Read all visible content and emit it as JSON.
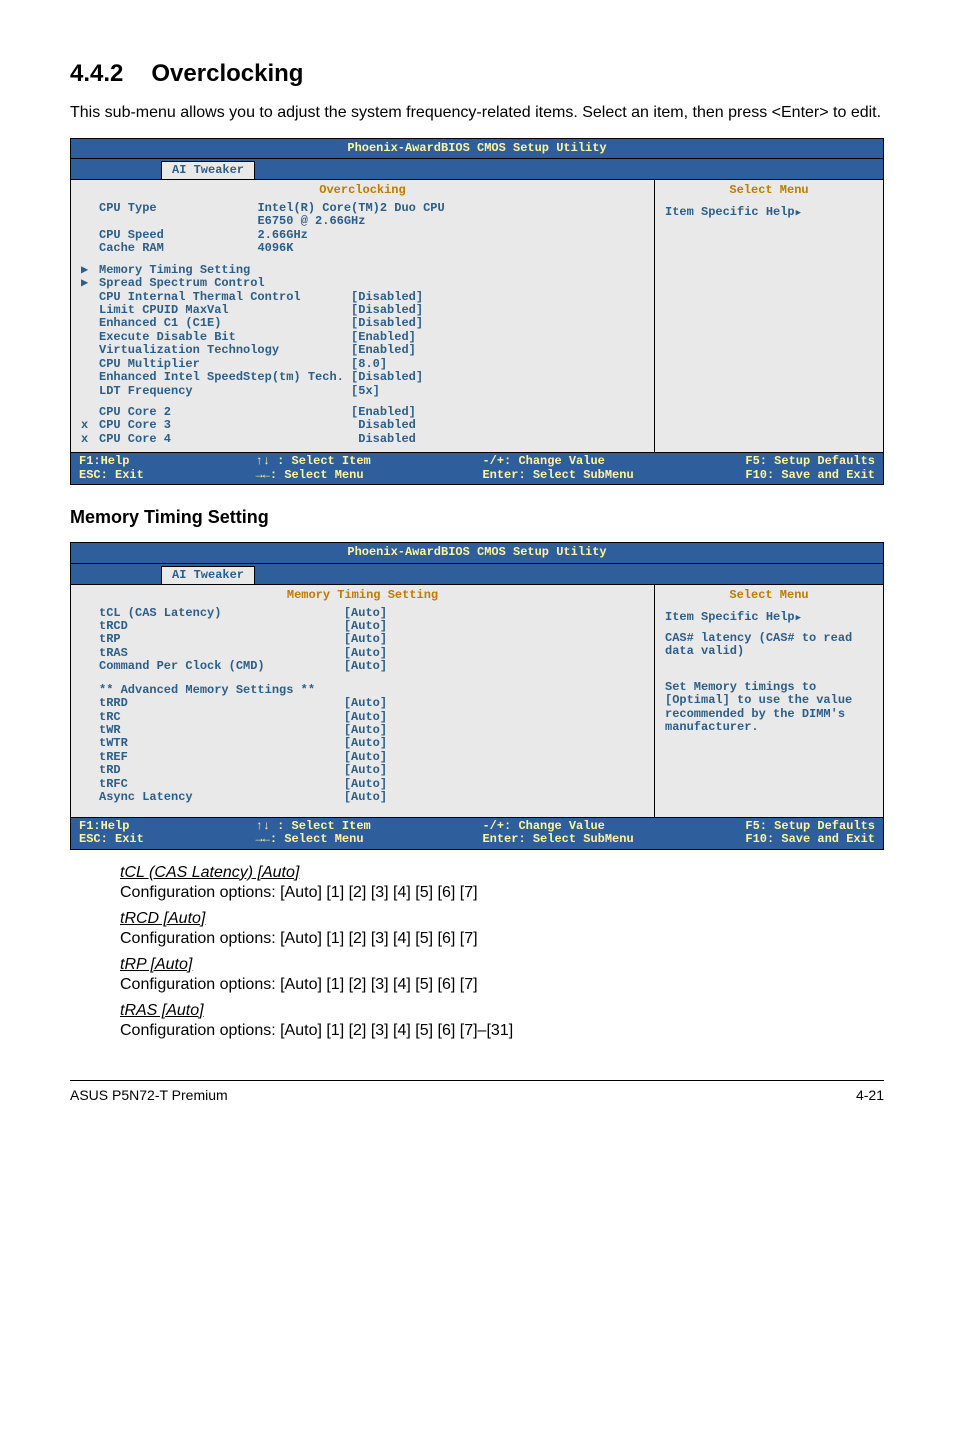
{
  "heading": {
    "number": "4.4.2",
    "title": "Overclocking"
  },
  "intro": "This sub-menu allows you to adjust the system frequency-related items. Select an item, then press <Enter> to edit.",
  "bios1": {
    "title": "Phoenix-AwardBIOS CMOS Setup Utility",
    "tab": "AI Tweaker",
    "left_header": "Overclocking",
    "right_header": "Select Menu",
    "help": "Item Specific Help",
    "info": [
      {
        "l": "CPU Type",
        "v": "Intel(R) Core(TM)2 Duo CPU"
      },
      {
        "l": "",
        "v": "E6750 @ 2.66GHz"
      },
      {
        "l": "CPU Speed",
        "v": "2.66GHz"
      },
      {
        "l": "Cache RAM",
        "v": "4096K"
      }
    ],
    "items": [
      {
        "p": "▶",
        "l": "Memory Timing Setting",
        "v": ""
      },
      {
        "p": "▶",
        "l": "Spread Spectrum Control",
        "v": ""
      },
      {
        "p": " ",
        "l": "CPU Internal Thermal Control",
        "v": "[Disabled]"
      },
      {
        "p": " ",
        "l": "Limit CPUID MaxVal",
        "v": "[Disabled]"
      },
      {
        "p": " ",
        "l": "Enhanced C1 (C1E)",
        "v": "[Disabled]"
      },
      {
        "p": " ",
        "l": "Execute Disable Bit",
        "v": "[Enabled]"
      },
      {
        "p": " ",
        "l": "Virtualization Technology",
        "v": "[Enabled]"
      },
      {
        "p": " ",
        "l": "CPU Multiplier",
        "v": "[8.0]"
      },
      {
        "p": " ",
        "l": "Enhanced Intel SpeedStep(tm) Tech.",
        "v": "[Disabled]"
      },
      {
        "p": " ",
        "l": "LDT Frequency",
        "v": "[5x]"
      }
    ],
    "cores": [
      {
        "p": " ",
        "l": "CPU Core 2",
        "v": "[Enabled]"
      },
      {
        "p": "x",
        "l": "CPU Core 3",
        "v": " Disabled"
      },
      {
        "p": "x",
        "l": "CPU Core 4",
        "v": " Disabled"
      }
    ],
    "footer": {
      "c1a": "F1:Help",
      "c1b": "ESC: Exit",
      "c2a": "↑↓ : Select Item",
      "c2b": "→←: Select Menu",
      "c3a": "-/+: Change Value",
      "c3b": "Enter: Select SubMenu",
      "c4a": "F5: Setup Defaults",
      "c4b": "F10: Save and Exit"
    }
  },
  "sub_title": "Memory Timing Setting",
  "bios2": {
    "title": "Phoenix-AwardBIOS CMOS Setup Utility",
    "tab": "AI Tweaker",
    "left_header": "Memory Timing Setting",
    "right_header": "Select Menu",
    "help1": "Item Specific Help",
    "help2": "CAS# latency (CAS# to read data valid)",
    "help3": "Set Memory timings to [Optimal] to use the value recommended by the DIMM's manufacturer.",
    "group1": [
      {
        "l": "tCL (CAS Latency)",
        "v": "[Auto]"
      },
      {
        "l": "tRCD",
        "v": "[Auto]"
      },
      {
        "l": "tRP",
        "v": "[Auto]"
      },
      {
        "l": "tRAS",
        "v": "[Auto]"
      },
      {
        "l": "Command Per Clock (CMD)",
        "v": "[Auto]"
      }
    ],
    "adv_header": "** Advanced Memory Settings **",
    "group2": [
      {
        "l": "tRRD",
        "v": "[Auto]"
      },
      {
        "l": "tRC",
        "v": "[Auto]"
      },
      {
        "l": "tWR",
        "v": "[Auto]"
      },
      {
        "l": "tWTR",
        "v": "[Auto]"
      },
      {
        "l": "tREF",
        "v": "[Auto]"
      },
      {
        "l": "tRD",
        "v": "[Auto]"
      },
      {
        "l": "tRFC",
        "v": "[Auto]"
      },
      {
        "l": "Async Latency",
        "v": "[Auto]"
      }
    ],
    "footer": {
      "c1a": "F1:Help",
      "c1b": "ESC: Exit",
      "c2a": "↑↓ : Select Item",
      "c2b": "→←: Select Menu",
      "c3a": "-/+: Change Value",
      "c3b": "Enter: Select SubMenu",
      "c4a": "F5: Setup Defaults",
      "c4b": "F10: Save and Exit"
    }
  },
  "defs": [
    {
      "t": "tCL (CAS Latency) [Auto]",
      "b": "Configuration options: [Auto] [1] [2] [3] [4] [5] [6] [7]"
    },
    {
      "t": "tRCD [Auto]",
      "b": "Configuration options: [Auto] [1] [2] [3] [4] [5] [6] [7]"
    },
    {
      "t": "tRP [Auto]",
      "b": "Configuration options: [Auto] [1] [2] [3] [4] [5] [6] [7]"
    },
    {
      "t": "tRAS [Auto]",
      "b": "Configuration options: [Auto] [1] [2] [3] [4] [5] [6] [7]–[31]"
    }
  ],
  "page_footer": {
    "left": "ASUS P5N72-T Premium",
    "right": "4-21"
  }
}
